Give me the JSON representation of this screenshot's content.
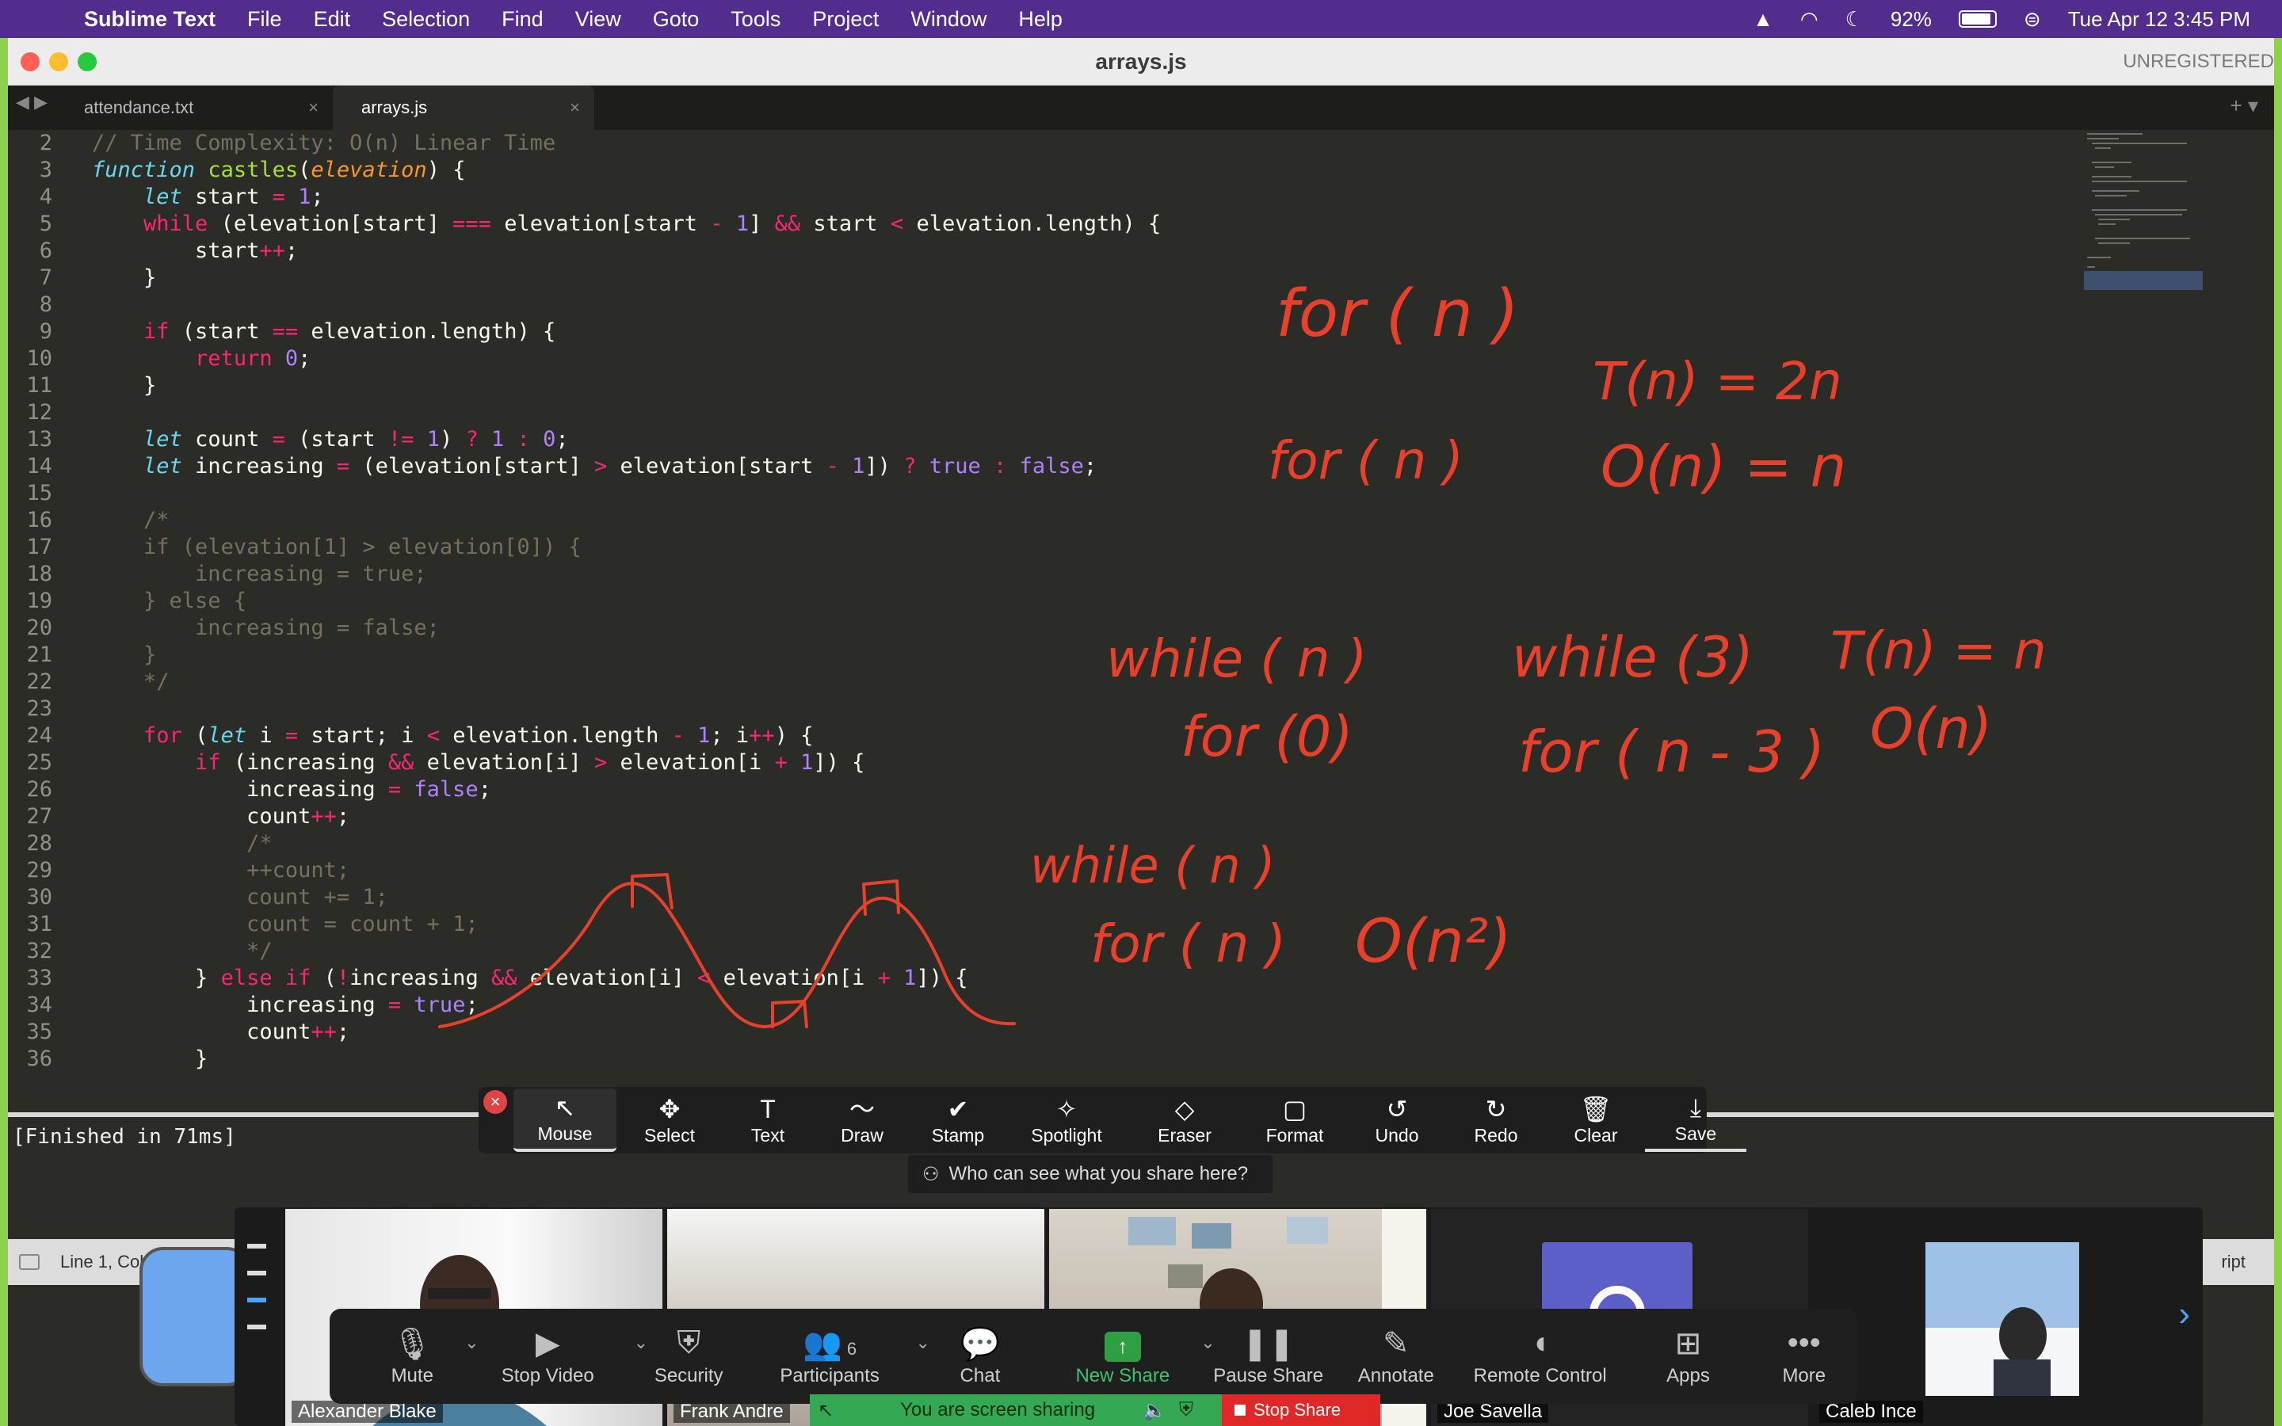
{
  "menubar": {
    "app_name": "Sublime Text",
    "items": [
      "File",
      "Edit",
      "Selection",
      "Find",
      "View",
      "Goto",
      "Tools",
      "Project",
      "Window",
      "Help"
    ],
    "battery": "92%",
    "datetime": "Tue Apr 12  3:45 PM"
  },
  "window": {
    "title": "arrays.js",
    "unregistered": "UNREGISTERED"
  },
  "tabs": [
    {
      "label": "attendance.txt",
      "active": false
    },
    {
      "label": "arrays.js",
      "active": true
    }
  ],
  "code_lines": [
    {
      "n": "2",
      "html": "<span class='cm'>// Time Complexity: O(n) Linear Time</span>"
    },
    {
      "n": "3",
      "html": "<span class='kwi'>function</span> <span class='fn'>castles</span>(<span class='par'>elevation</span>) {"
    },
    {
      "n": "4",
      "html": "    <span class='kwi'>let</span> start <span class='op'>=</span> <span class='num'>1</span>;"
    },
    {
      "n": "5",
      "html": "    <span class='kw'>while</span> (elevation[start] <span class='op'>===</span> elevation[start <span class='op'>-</span> <span class='num'>1</span>] <span class='op'>&amp;&amp;</span> start <span class='op'>&lt;</span> elevation.length) {"
    },
    {
      "n": "6",
      "html": "        start<span class='op'>++</span>;"
    },
    {
      "n": "7",
      "html": "    }"
    },
    {
      "n": "8",
      "html": ""
    },
    {
      "n": "9",
      "html": "    <span class='kw'>if</span> (start <span class='op'>==</span> elevation.length) {"
    },
    {
      "n": "10",
      "html": "        <span class='kw'>return</span> <span class='num'>0</span>;"
    },
    {
      "n": "11",
      "html": "    }"
    },
    {
      "n": "12",
      "html": ""
    },
    {
      "n": "13",
      "html": "    <span class='kwi'>let</span> count <span class='op'>=</span> (start <span class='op'>!=</span> <span class='num'>1</span>) <span class='op'>?</span> <span class='num'>1</span> <span class='op'>:</span> <span class='num'>0</span>;"
    },
    {
      "n": "14",
      "html": "    <span class='kwi'>let</span> increasing <span class='op'>=</span> (elevation[start] <span class='op'>&gt;</span> elevation[start <span class='op'>-</span> <span class='num'>1</span>]) <span class='op'>?</span> <span class='num'>true</span> <span class='op'>:</span> <span class='num'>false</span>;"
    },
    {
      "n": "15",
      "html": ""
    },
    {
      "n": "16",
      "html": "    <span class='cm'>/*</span>"
    },
    {
      "n": "17",
      "html": "    <span class='cm'>if (elevation[1] &gt; elevation[0]) {</span>"
    },
    {
      "n": "18",
      "html": "        <span class='cm'>increasing = true;</span>"
    },
    {
      "n": "19",
      "html": "    <span class='cm'>} else {</span>"
    },
    {
      "n": "20",
      "html": "        <span class='cm'>increasing = false;</span>"
    },
    {
      "n": "21",
      "html": "    <span class='cm'>}</span>"
    },
    {
      "n": "22",
      "html": "    <span class='cm'>*/</span>"
    },
    {
      "n": "23",
      "html": ""
    },
    {
      "n": "24",
      "html": "    <span class='kw'>for</span> (<span class='kwi'>let</span> i <span class='op'>=</span> start; i <span class='op'>&lt;</span> elevation.length <span class='op'>-</span> <span class='num'>1</span>; i<span class='op'>++</span>) {"
    },
    {
      "n": "25",
      "html": "        <span class='kw'>if</span> (increasing <span class='op'>&amp;&amp;</span> elevation[i] <span class='op'>&gt;</span> elevation[i <span class='op'>+</span> <span class='num'>1</span>]) {"
    },
    {
      "n": "26",
      "html": "            increasing <span class='op'>=</span> <span class='num'>false</span>;"
    },
    {
      "n": "27",
      "html": "            count<span class='op'>++</span>;"
    },
    {
      "n": "28",
      "html": "            <span class='cm'>/*</span>"
    },
    {
      "n": "29",
      "html": "            <span class='cm'>++count;</span>"
    },
    {
      "n": "30",
      "html": "            <span class='cm'>count += 1;</span>"
    },
    {
      "n": "31",
      "html": "            <span class='cm'>count = count + 1;</span>"
    },
    {
      "n": "32",
      "html": "            <span class='cm'>*/</span>"
    },
    {
      "n": "33",
      "html": "        } <span class='kw'>else if</span> (<span class='op'>!</span>increasing <span class='op'>&amp;&amp;</span> elevation[i] <span class='op'>&lt;</span> elevation[i <span class='op'>+</span> <span class='num'>1</span>]) {"
    },
    {
      "n": "34",
      "html": "            increasing <span class='op'>=</span> <span class='num'>true</span>;"
    },
    {
      "n": "35",
      "html": "            count<span class='op'>++</span>;"
    },
    {
      "n": "36",
      "html": "        }"
    }
  ],
  "annotations": {
    "for_n_1": "for ( n )",
    "for_n_2": "for ( n )",
    "t_2n": "T(n) = 2n",
    "o_n": "O(n) = n",
    "while_n": "while ( n )",
    "for_0": "for (0)",
    "while_3": "while (3)",
    "for_n_3": "for ( n - 3 )",
    "t_n": "T(n) = n",
    "o_n_2": "O(n)",
    "while_n_2": "while ( n )",
    "for_n_4": "for ( n )",
    "o_n2": "O(n²)",
    "ink_color": "#e8402a"
  },
  "output": {
    "text": "[Finished in 71ms]"
  },
  "statusbar": {
    "position": "Line 1, Column 76",
    "syntax": "ript"
  },
  "annot_toolbar": {
    "tools": [
      {
        "label": "Mouse",
        "icon": "↖"
      },
      {
        "label": "Select",
        "icon": "✥"
      },
      {
        "label": "Text",
        "icon": "T"
      },
      {
        "label": "Draw",
        "icon": "〜"
      },
      {
        "label": "Stamp",
        "icon": "✔"
      },
      {
        "label": "Spotlight",
        "icon": "✧"
      },
      {
        "label": "Eraser",
        "icon": "◇"
      },
      {
        "label": "Format",
        "icon": "▢"
      },
      {
        "label": "Undo",
        "icon": "↺"
      },
      {
        "label": "Redo",
        "icon": "↻"
      },
      {
        "label": "Clear",
        "icon": "🗑"
      },
      {
        "label": "Save",
        "icon": "⤓"
      }
    ],
    "who_can_see": "Who can see what you share here?"
  },
  "gallery": {
    "participants": [
      {
        "name": "Alexander Blake"
      },
      {
        "name": "Frank Andre"
      },
      {
        "name": ""
      },
      {
        "name": "Joe Savella"
      },
      {
        "name": "Caleb Ince"
      }
    ]
  },
  "zoom_controls": {
    "items": [
      {
        "label": "Mute",
        "icon": "🎙"
      },
      {
        "label": "Stop Video",
        "icon": "▶"
      },
      {
        "label": "Security",
        "icon": "⛨"
      },
      {
        "label": "Participants",
        "icon": "👥",
        "count": "6"
      },
      {
        "label": "Chat",
        "icon": "💬"
      },
      {
        "label": "New Share",
        "icon": "↑"
      },
      {
        "label": "Pause Share",
        "icon": "❚❚"
      },
      {
        "label": "Annotate",
        "icon": "✎"
      },
      {
        "label": "Remote Control",
        "icon": "◖"
      },
      {
        "label": "Apps",
        "icon": "⊞"
      },
      {
        "label": "More",
        "icon": "•••"
      }
    ],
    "sharing_text": "You are screen sharing",
    "stop_share": "Stop Share"
  }
}
